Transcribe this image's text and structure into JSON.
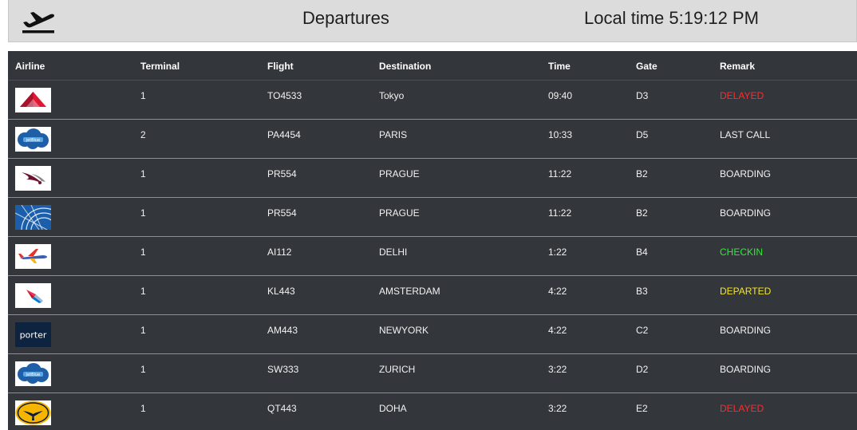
{
  "header": {
    "title": "Departures",
    "clock_label": "Local time",
    "clock_value": "5:19:12 PM"
  },
  "icons": {
    "departure": "plane-takeoff-icon"
  },
  "columns": [
    "Airline",
    "Terminal",
    "Flight",
    "Destination",
    "Time",
    "Gate",
    "Remark"
  ],
  "colors": {
    "board_bg": "#33363b",
    "header_bg": "#dcdcdc",
    "delayed": "#ff2b2b",
    "checkin": "#39e639",
    "departed": "#f5e61f",
    "default": "#f2f2f2"
  },
  "flights": [
    {
      "logo": "delta-logo",
      "terminal": "1",
      "flight": "TO4533",
      "destination": "Tokyo",
      "time": "09:40",
      "gate": "D3",
      "remark": "DELAYED",
      "status": "red"
    },
    {
      "logo": "jetblue-logo",
      "terminal": "2",
      "flight": "PA4454",
      "destination": "PARIS",
      "time": "10:33",
      "gate": "D5",
      "remark": "LAST CALL",
      "status": "white"
    },
    {
      "logo": "qatar-logo",
      "terminal": "1",
      "flight": "PR554",
      "destination": "PRAGUE",
      "time": "11:22",
      "gate": "B2",
      "remark": "BOARDING",
      "status": "white"
    },
    {
      "logo": "united-logo",
      "terminal": "1",
      "flight": "PR554",
      "destination": "PRAGUE",
      "time": "11:22",
      "gate": "B2",
      "remark": "BOARDING",
      "status": "white"
    },
    {
      "logo": "southwest-logo",
      "terminal": "1",
      "flight": "AI112",
      "destination": "DELHI",
      "time": "1:22",
      "gate": "B4",
      "remark": "CHECKIN",
      "status": "green"
    },
    {
      "logo": "american-logo",
      "terminal": "1",
      "flight": "KL443",
      "destination": "AMSTERDAM",
      "time": "4:22",
      "gate": "B3",
      "remark": "DEPARTED",
      "status": "yellow"
    },
    {
      "logo": "porter-logo",
      "logo_text": "porter",
      "terminal": "1",
      "flight": "AM443",
      "destination": "NEWYORK",
      "time": "4:22",
      "gate": "C2",
      "remark": "BOARDING",
      "status": "white"
    },
    {
      "logo": "jetblue-logo",
      "terminal": "1",
      "flight": "SW333",
      "destination": "ZURICH",
      "time": "3:22",
      "gate": "D2",
      "remark": "BOARDING",
      "status": "white"
    },
    {
      "logo": "lufthansa-logo",
      "terminal": "1",
      "flight": "QT443",
      "destination": "DOHA",
      "time": "3:22",
      "gate": "E2",
      "remark": "DELAYED",
      "status": "red"
    }
  ]
}
